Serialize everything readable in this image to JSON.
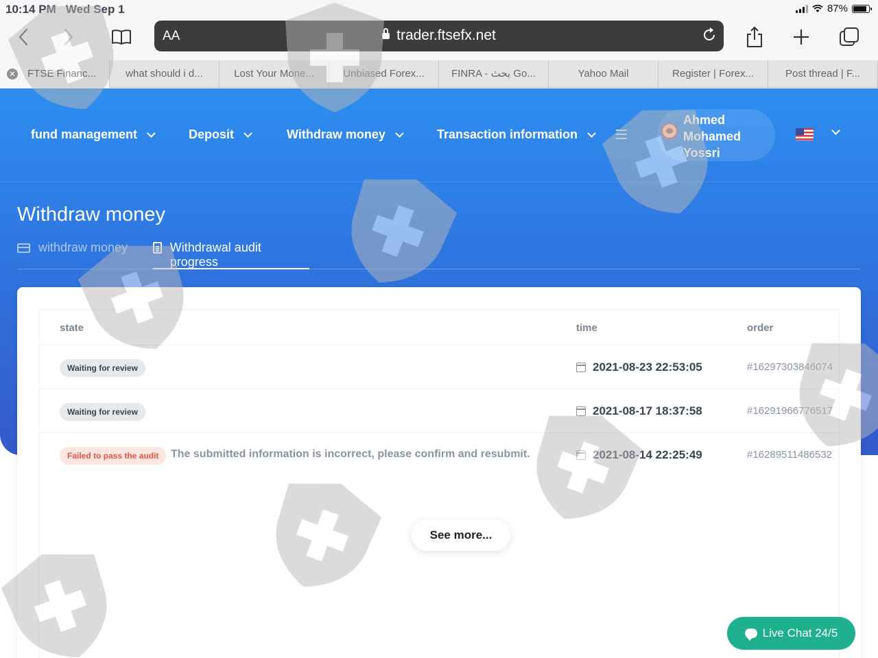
{
  "status_bar": {
    "time": "10:14 PM",
    "date": "Wed Sep 1",
    "battery": "87%",
    "battery_level": 0.87
  },
  "browser": {
    "url": "trader.ftsefx.net",
    "reader_label": "AA",
    "tabs": [
      {
        "label": "FTSE Financ...",
        "active": true
      },
      {
        "label": "what should i d...",
        "active": false
      },
      {
        "label": "Lost Your Mone...",
        "active": false
      },
      {
        "label": "Unbiased Forex...",
        "active": false
      },
      {
        "label": "FINRA - بحث Go...",
        "active": false
      },
      {
        "label": "Yahoo Mail",
        "active": false
      },
      {
        "label": "Register | Forex...",
        "active": false
      },
      {
        "label": "Post thread | F...",
        "active": false
      }
    ]
  },
  "nav": {
    "items": [
      "fund management",
      "Deposit",
      "Withdraw money",
      "Transaction information"
    ],
    "user_name": "Ahmed Mohamed Yossri"
  },
  "page": {
    "title": "Withdraw money",
    "subnav": {
      "inactive": "withdraw money",
      "active": "Withdrawal audit progress"
    }
  },
  "table": {
    "headers": {
      "state": "state",
      "time": "time",
      "order": "order"
    },
    "rows": [
      {
        "state": "Waiting for review",
        "reason": "",
        "time": "2021-08-23 22:53:05",
        "order": "#16297303846074"
      },
      {
        "state": "Waiting for review",
        "reason": "",
        "time": "2021-08-17 18:37:58",
        "order": "#16291966776517"
      },
      {
        "state": "Failed to pass the audit",
        "reason": "The submitted information is incorrect, please confirm and resubmit.",
        "time": "2021-08-14 22:25:49",
        "order": "#16289511486532"
      }
    ],
    "see_more": "See more..."
  },
  "live_chat": "Live Chat 24/5",
  "colors": {
    "hero_top": "#2d8ef0",
    "hero_bottom": "#3559cb",
    "chat": "#1fb18f",
    "fail_text": "#e2553f"
  }
}
